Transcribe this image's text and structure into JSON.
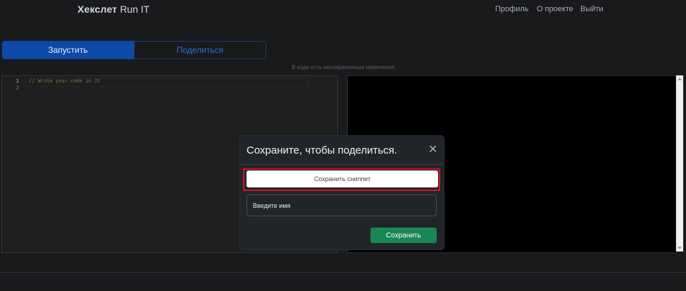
{
  "header": {
    "brand": "Хекслет",
    "product": "Run IT",
    "nav": {
      "profile": "Профиль",
      "about": "О проекте",
      "logout": "Выйти"
    }
  },
  "toolbar": {
    "run_label": "Запустить",
    "share_label": "Поделиться",
    "unsaved_notice": "В коде есть несохраненные изменения"
  },
  "editor": {
    "line_numbers": [
      "1",
      "2"
    ],
    "code": "// Write your code in JS"
  },
  "modal": {
    "title": "Сохраните, чтобы поделиться.",
    "close_icon": "close-icon",
    "save_snippet_label": "Сохранить сниппет",
    "name_placeholder": "Введите имя",
    "save_label": "Сохранить"
  },
  "colors": {
    "primary": "#0d49a8",
    "success": "#198754",
    "highlight": "#d7131f"
  }
}
